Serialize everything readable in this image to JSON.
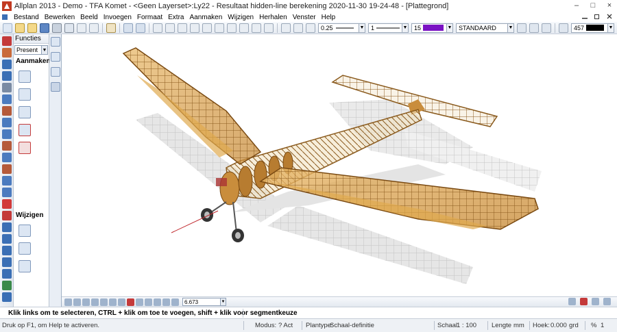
{
  "window": {
    "title": "Allplan 2013 - Demo - TFA Komet - <Geen Layerset>:Ly22 - Resultaat hidden-line berekening 2020-11-30 19-24-48 - [Plattegrond]",
    "controls": [
      "–",
      "□",
      "×"
    ]
  },
  "menu": {
    "items": [
      "Bestand",
      "Bewerken",
      "Beeld",
      "Invoegen",
      "Formaat",
      "Extra",
      "Aanmaken",
      "Wijzigen",
      "Herhalen",
      "Venster",
      "Help"
    ]
  },
  "toolbar": {
    "pen_value": "0.25",
    "line_value": "1",
    "color_value": "15",
    "color_swatch": "#7a12c4",
    "style_value": "STANDAARD",
    "layer_value": "457"
  },
  "panel": {
    "header": "Functies",
    "select_value": "Present",
    "section_create": "Aanmaken",
    "section_modify": "Wijzigen"
  },
  "view_toolbar": {
    "zoom_value": "6.673"
  },
  "hint": {
    "text": "Klik links om te selecteren, CTRL + klik om toe te voegen, shift + klik voor segmentkeuze"
  },
  "status": {
    "help": "Druk op F1, om Help te activeren.",
    "modus": "Modus:",
    "modus_value": "? Act",
    "plantype_label": "Plantype:",
    "plantype_value": "Schaal-definitie",
    "schaal_label": "Schaal",
    "schaal_value": "1 : 100",
    "lengte_label": "Lengte",
    "lengte_value": "mm",
    "hoek_label": "Hoek:",
    "hoek_value": "0.000",
    "hoek_unit": "grd",
    "percent": "%",
    "percent_value": "1"
  },
  "colors": {
    "accent": "#2f6ab5",
    "wood": "#d9a24a",
    "wood_dark": "#8a5a1d"
  }
}
